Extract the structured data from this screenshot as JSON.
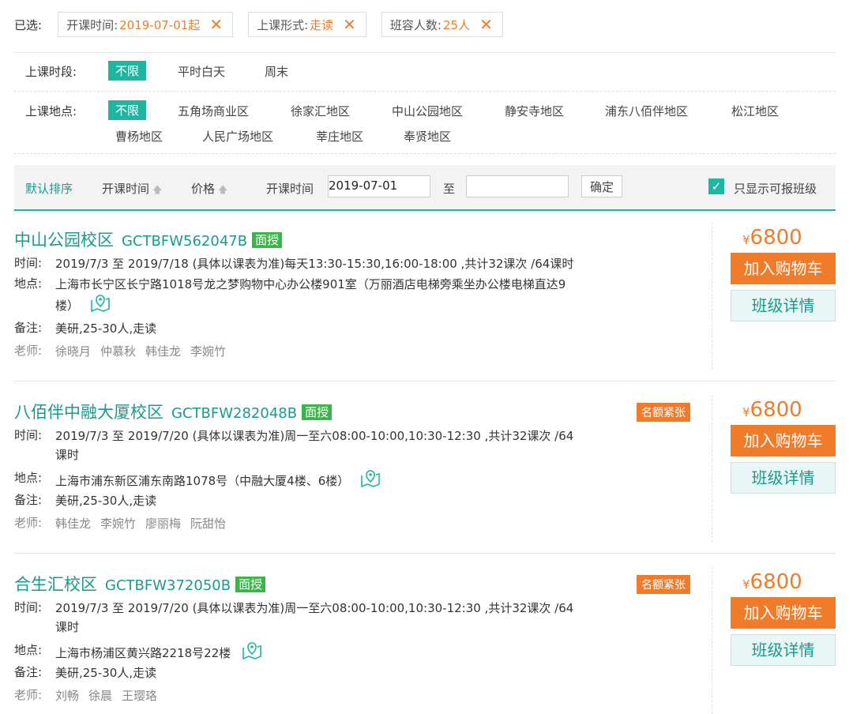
{
  "selected": {
    "label": "已选:",
    "tags": [
      {
        "key": "开课时间:",
        "value": "2019-07-01起"
      },
      {
        "key": "上课形式:",
        "value": "走读"
      },
      {
        "key": "班容人数:",
        "value": "25人"
      }
    ]
  },
  "period": {
    "label": "上课时段:",
    "options": [
      "不限",
      "平时白天",
      "周末"
    ]
  },
  "location": {
    "label": "上课地点:",
    "options": [
      "不限",
      "五角场商业区",
      "徐家汇地区",
      "中山公园地区",
      "静安寺地区",
      "浦东八佰伴地区",
      "松江地区",
      "曹杨地区",
      "人民广场地区",
      "莘庄地区",
      "奉贤地区"
    ]
  },
  "sort": {
    "default": "默认排序",
    "start_time": "开课时间",
    "price": "价格",
    "date_label": "开课时间",
    "date_from": "2019-07-01",
    "date_to": "",
    "to": "至",
    "confirm": "确定",
    "only_available": "只显示可报班级"
  },
  "labels": {
    "time": "时间:",
    "place": "地点:",
    "note": "备注:",
    "teacher": "老师:",
    "add_cart": "加入购物车",
    "details": "班级详情",
    "yen": "¥",
    "hot": "名额紧张"
  },
  "courses": [
    {
      "campus": "中山公园校区",
      "code": "GCTBFW562047B",
      "mode": "面授",
      "time": "2019/7/3 至 2019/7/18 (具体以课表为准)每天13:30-15:30,16:00-18:00 ,共计32课次 /64课时",
      "place": "上海市长宁区长宁路1018号龙之梦购物中心办公楼901室（万丽酒店电梯旁乘坐办公楼电梯直达9楼）",
      "note": "美研,25-30人,走读",
      "teachers": [
        "徐晓月",
        "仲慕秋",
        "韩佳龙",
        "李婉竹"
      ],
      "price": "6800",
      "hot": false
    },
    {
      "campus": "八佰伴中融大厦校区",
      "code": "GCTBFW282048B",
      "mode": "面授",
      "time": "2019/7/3 至 2019/7/20 (具体以课表为准)周一至六08:00-10:00,10:30-12:30 ,共计32课次 /64课时",
      "place": "上海市浦东新区浦东南路1078号（中融大厦4楼、6楼）",
      "note": "美研,25-30人,走读",
      "teachers": [
        "韩佳龙",
        "李婉竹",
        "廖丽梅",
        "阮甜怡"
      ],
      "price": "6800",
      "hot": true
    },
    {
      "campus": "合生汇校区",
      "code": "GCTBFW372050B",
      "mode": "面授",
      "time": "2019/7/3 至 2019/7/20 (具体以课表为准)周一至六08:00-10:00,10:30-12:30 ,共计32课次 /64课时",
      "place": "上海市杨浦区黄兴路2218号22楼",
      "note": "美研,25-30人,走读",
      "teachers": [
        "刘畅",
        "徐晨",
        "王璎珞"
      ],
      "price": "6800",
      "hot": true
    }
  ],
  "colors": {
    "teal": "#1fb5a3",
    "orange": "#f07c2b",
    "green_badge": "#3bb54a"
  }
}
